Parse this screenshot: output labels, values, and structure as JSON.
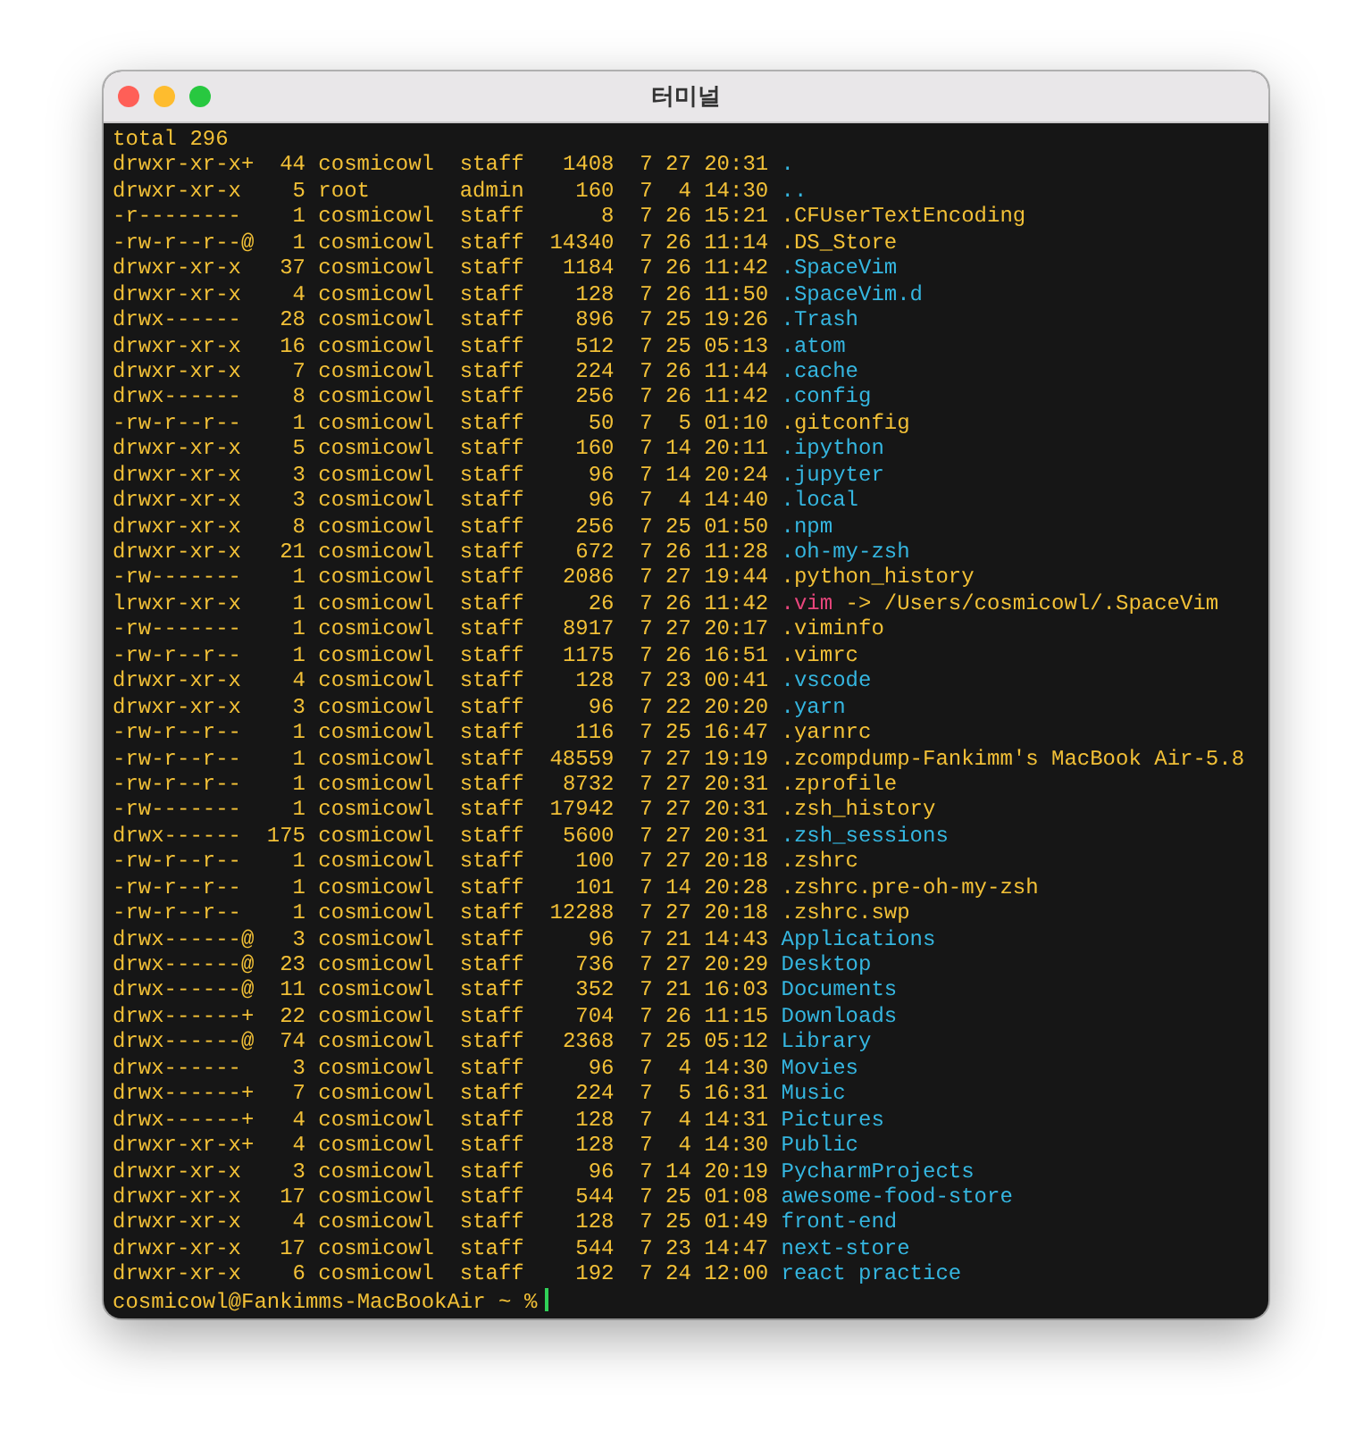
{
  "window": {
    "title": "터미널"
  },
  "terminal": {
    "total": "total 296",
    "rows": [
      {
        "mode": "drwxr-xr-x+",
        "links": "44",
        "owner": "cosmicowl",
        "group": "staff",
        "size": "1408",
        "month": "7",
        "day": "27",
        "time": "20:31",
        "name": ".",
        "kind": "dir"
      },
      {
        "mode": "drwxr-xr-x",
        "links": "5",
        "owner": "root",
        "group": "admin",
        "size": "160",
        "month": "7",
        "day": "4",
        "time": "14:30",
        "name": "..",
        "kind": "dir"
      },
      {
        "mode": "-r--------",
        "links": "1",
        "owner": "cosmicowl",
        "group": "staff",
        "size": "8",
        "month": "7",
        "day": "26",
        "time": "15:21",
        "name": ".CFUserTextEncoding",
        "kind": "file"
      },
      {
        "mode": "-rw-r--r--@",
        "links": "1",
        "owner": "cosmicowl",
        "group": "staff",
        "size": "14340",
        "month": "7",
        "day": "26",
        "time": "11:14",
        "name": ".DS_Store",
        "kind": "file"
      },
      {
        "mode": "drwxr-xr-x",
        "links": "37",
        "owner": "cosmicowl",
        "group": "staff",
        "size": "1184",
        "month": "7",
        "day": "26",
        "time": "11:42",
        "name": ".SpaceVim",
        "kind": "dir"
      },
      {
        "mode": "drwxr-xr-x",
        "links": "4",
        "owner": "cosmicowl",
        "group": "staff",
        "size": "128",
        "month": "7",
        "day": "26",
        "time": "11:50",
        "name": ".SpaceVim.d",
        "kind": "dir"
      },
      {
        "mode": "drwx------",
        "links": "28",
        "owner": "cosmicowl",
        "group": "staff",
        "size": "896",
        "month": "7",
        "day": "25",
        "time": "19:26",
        "name": ".Trash",
        "kind": "dir"
      },
      {
        "mode": "drwxr-xr-x",
        "links": "16",
        "owner": "cosmicowl",
        "group": "staff",
        "size": "512",
        "month": "7",
        "day": "25",
        "time": "05:13",
        "name": ".atom",
        "kind": "dir"
      },
      {
        "mode": "drwxr-xr-x",
        "links": "7",
        "owner": "cosmicowl",
        "group": "staff",
        "size": "224",
        "month": "7",
        "day": "26",
        "time": "11:44",
        "name": ".cache",
        "kind": "dir"
      },
      {
        "mode": "drwx------",
        "links": "8",
        "owner": "cosmicowl",
        "group": "staff",
        "size": "256",
        "month": "7",
        "day": "26",
        "time": "11:42",
        "name": ".config",
        "kind": "dir"
      },
      {
        "mode": "-rw-r--r--",
        "links": "1",
        "owner": "cosmicowl",
        "group": "staff",
        "size": "50",
        "month": "7",
        "day": "5",
        "time": "01:10",
        "name": ".gitconfig",
        "kind": "file"
      },
      {
        "mode": "drwxr-xr-x",
        "links": "5",
        "owner": "cosmicowl",
        "group": "staff",
        "size": "160",
        "month": "7",
        "day": "14",
        "time": "20:11",
        "name": ".ipython",
        "kind": "dir"
      },
      {
        "mode": "drwxr-xr-x",
        "links": "3",
        "owner": "cosmicowl",
        "group": "staff",
        "size": "96",
        "month": "7",
        "day": "14",
        "time": "20:24",
        "name": ".jupyter",
        "kind": "dir"
      },
      {
        "mode": "drwxr-xr-x",
        "links": "3",
        "owner": "cosmicowl",
        "group": "staff",
        "size": "96",
        "month": "7",
        "day": "4",
        "time": "14:40",
        "name": ".local",
        "kind": "dir"
      },
      {
        "mode": "drwxr-xr-x",
        "links": "8",
        "owner": "cosmicowl",
        "group": "staff",
        "size": "256",
        "month": "7",
        "day": "25",
        "time": "01:50",
        "name": ".npm",
        "kind": "dir"
      },
      {
        "mode": "drwxr-xr-x",
        "links": "21",
        "owner": "cosmicowl",
        "group": "staff",
        "size": "672",
        "month": "7",
        "day": "26",
        "time": "11:28",
        "name": ".oh-my-zsh",
        "kind": "dir"
      },
      {
        "mode": "-rw-------",
        "links": "1",
        "owner": "cosmicowl",
        "group": "staff",
        "size": "2086",
        "month": "7",
        "day": "27",
        "time": "19:44",
        "name": ".python_history",
        "kind": "file"
      },
      {
        "mode": "lrwxr-xr-x",
        "links": "1",
        "owner": "cosmicowl",
        "group": "staff",
        "size": "26",
        "month": "7",
        "day": "26",
        "time": "11:42",
        "name": ".vim",
        "kind": "link",
        "arrow": "->",
        "target": "/Users/cosmicowl/.SpaceVim"
      },
      {
        "mode": "-rw-------",
        "links": "1",
        "owner": "cosmicowl",
        "group": "staff",
        "size": "8917",
        "month": "7",
        "day": "27",
        "time": "20:17",
        "name": ".viminfo",
        "kind": "file"
      },
      {
        "mode": "-rw-r--r--",
        "links": "1",
        "owner": "cosmicowl",
        "group": "staff",
        "size": "1175",
        "month": "7",
        "day": "26",
        "time": "16:51",
        "name": ".vimrc",
        "kind": "file"
      },
      {
        "mode": "drwxr-xr-x",
        "links": "4",
        "owner": "cosmicowl",
        "group": "staff",
        "size": "128",
        "month": "7",
        "day": "23",
        "time": "00:41",
        "name": ".vscode",
        "kind": "dir"
      },
      {
        "mode": "drwxr-xr-x",
        "links": "3",
        "owner": "cosmicowl",
        "group": "staff",
        "size": "96",
        "month": "7",
        "day": "22",
        "time": "20:20",
        "name": ".yarn",
        "kind": "dir"
      },
      {
        "mode": "-rw-r--r--",
        "links": "1",
        "owner": "cosmicowl",
        "group": "staff",
        "size": "116",
        "month": "7",
        "day": "25",
        "time": "16:47",
        "name": ".yarnrc",
        "kind": "file"
      },
      {
        "mode": "-rw-r--r--",
        "links": "1",
        "owner": "cosmicowl",
        "group": "staff",
        "size": "48559",
        "month": "7",
        "day": "27",
        "time": "19:19",
        "name": ".zcompdump-Fankimm's MacBook Air-5.8",
        "kind": "file"
      },
      {
        "mode": "-rw-r--r--",
        "links": "1",
        "owner": "cosmicowl",
        "group": "staff",
        "size": "8732",
        "month": "7",
        "day": "27",
        "time": "20:31",
        "name": ".zprofile",
        "kind": "file"
      },
      {
        "mode": "-rw-------",
        "links": "1",
        "owner": "cosmicowl",
        "group": "staff",
        "size": "17942",
        "month": "7",
        "day": "27",
        "time": "20:31",
        "name": ".zsh_history",
        "kind": "file"
      },
      {
        "mode": "drwx------",
        "links": "175",
        "owner": "cosmicowl",
        "group": "staff",
        "size": "5600",
        "month": "7",
        "day": "27",
        "time": "20:31",
        "name": ".zsh_sessions",
        "kind": "dir"
      },
      {
        "mode": "-rw-r--r--",
        "links": "1",
        "owner": "cosmicowl",
        "group": "staff",
        "size": "100",
        "month": "7",
        "day": "27",
        "time": "20:18",
        "name": ".zshrc",
        "kind": "file"
      },
      {
        "mode": "-rw-r--r--",
        "links": "1",
        "owner": "cosmicowl",
        "group": "staff",
        "size": "101",
        "month": "7",
        "day": "14",
        "time": "20:28",
        "name": ".zshrc.pre-oh-my-zsh",
        "kind": "file"
      },
      {
        "mode": "-rw-r--r--",
        "links": "1",
        "owner": "cosmicowl",
        "group": "staff",
        "size": "12288",
        "month": "7",
        "day": "27",
        "time": "20:18",
        "name": ".zshrc.swp",
        "kind": "file"
      },
      {
        "mode": "drwx------@",
        "links": "3",
        "owner": "cosmicowl",
        "group": "staff",
        "size": "96",
        "month": "7",
        "day": "21",
        "time": "14:43",
        "name": "Applications",
        "kind": "dir"
      },
      {
        "mode": "drwx------@",
        "links": "23",
        "owner": "cosmicowl",
        "group": "staff",
        "size": "736",
        "month": "7",
        "day": "27",
        "time": "20:29",
        "name": "Desktop",
        "kind": "dir"
      },
      {
        "mode": "drwx------@",
        "links": "11",
        "owner": "cosmicowl",
        "group": "staff",
        "size": "352",
        "month": "7",
        "day": "21",
        "time": "16:03",
        "name": "Documents",
        "kind": "dir"
      },
      {
        "mode": "drwx------+",
        "links": "22",
        "owner": "cosmicowl",
        "group": "staff",
        "size": "704",
        "month": "7",
        "day": "26",
        "time": "11:15",
        "name": "Downloads",
        "kind": "dir"
      },
      {
        "mode": "drwx------@",
        "links": "74",
        "owner": "cosmicowl",
        "group": "staff",
        "size": "2368",
        "month": "7",
        "day": "25",
        "time": "05:12",
        "name": "Library",
        "kind": "dir"
      },
      {
        "mode": "drwx------",
        "links": "3",
        "owner": "cosmicowl",
        "group": "staff",
        "size": "96",
        "month": "7",
        "day": "4",
        "time": "14:30",
        "name": "Movies",
        "kind": "dir"
      },
      {
        "mode": "drwx------+",
        "links": "7",
        "owner": "cosmicowl",
        "group": "staff",
        "size": "224",
        "month": "7",
        "day": "5",
        "time": "16:31",
        "name": "Music",
        "kind": "dir"
      },
      {
        "mode": "drwx------+",
        "links": "4",
        "owner": "cosmicowl",
        "group": "staff",
        "size": "128",
        "month": "7",
        "day": "4",
        "time": "14:31",
        "name": "Pictures",
        "kind": "dir"
      },
      {
        "mode": "drwxr-xr-x+",
        "links": "4",
        "owner": "cosmicowl",
        "group": "staff",
        "size": "128",
        "month": "7",
        "day": "4",
        "time": "14:30",
        "name": "Public",
        "kind": "dir"
      },
      {
        "mode": "drwxr-xr-x",
        "links": "3",
        "owner": "cosmicowl",
        "group": "staff",
        "size": "96",
        "month": "7",
        "day": "14",
        "time": "20:19",
        "name": "PycharmProjects",
        "kind": "dir"
      },
      {
        "mode": "drwxr-xr-x",
        "links": "17",
        "owner": "cosmicowl",
        "group": "staff",
        "size": "544",
        "month": "7",
        "day": "25",
        "time": "01:08",
        "name": "awesome-food-store",
        "kind": "dir"
      },
      {
        "mode": "drwxr-xr-x",
        "links": "4",
        "owner": "cosmicowl",
        "group": "staff",
        "size": "128",
        "month": "7",
        "day": "25",
        "time": "01:49",
        "name": "front-end",
        "kind": "dir"
      },
      {
        "mode": "drwxr-xr-x",
        "links": "17",
        "owner": "cosmicowl",
        "group": "staff",
        "size": "544",
        "month": "7",
        "day": "23",
        "time": "14:47",
        "name": "next-store",
        "kind": "dir"
      },
      {
        "mode": "drwxr-xr-x",
        "links": "6",
        "owner": "cosmicowl",
        "group": "staff",
        "size": "192",
        "month": "7",
        "day": "24",
        "time": "12:00",
        "name": "react practice",
        "kind": "dir"
      }
    ],
    "prompt": "cosmicowl@Fankimms-MacBookAir ~ %"
  }
}
